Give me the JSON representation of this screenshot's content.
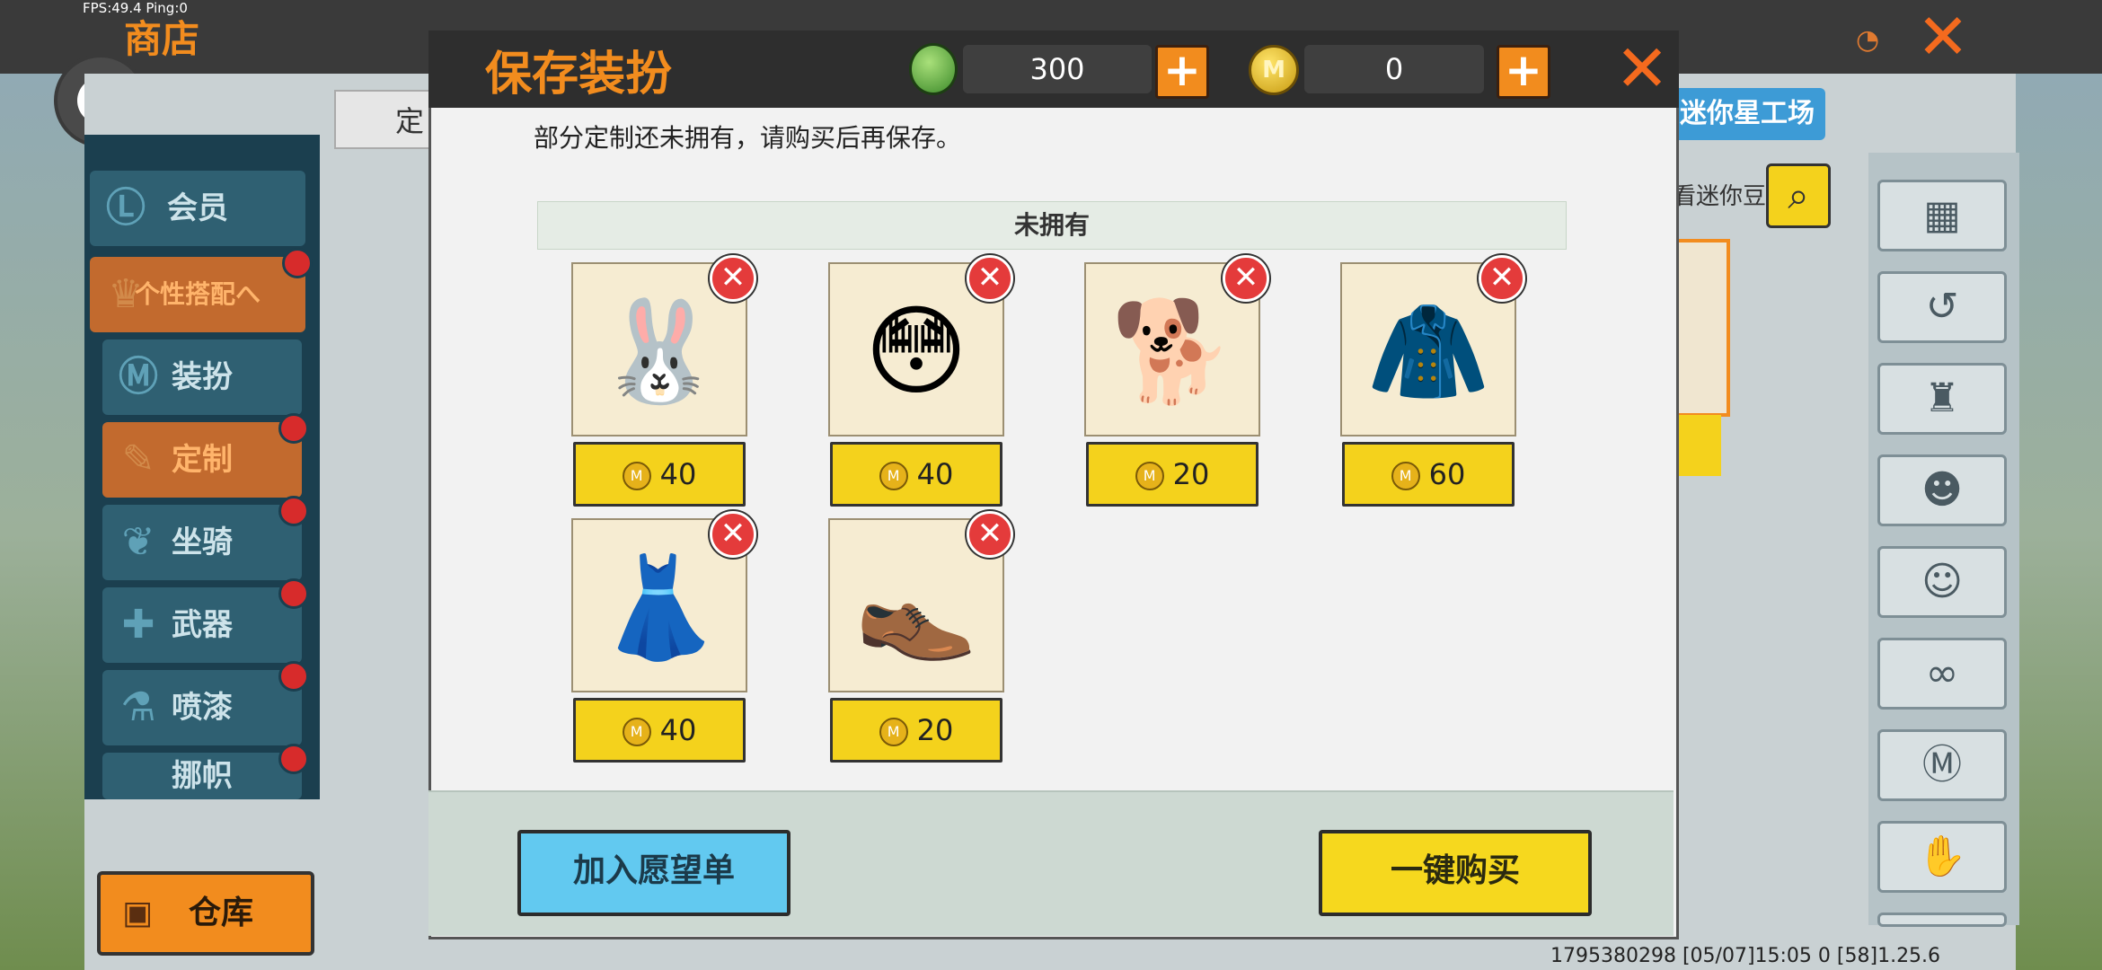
{
  "hud": {
    "fps": "FPS:49.4  Ping:0"
  },
  "shop": {
    "title": "商店",
    "tab_custom": "定",
    "workshop": "迷你星工场",
    "search_text": "看迷你豆",
    "storage": "仓库",
    "sidebar": [
      {
        "label": "会员",
        "active": false,
        "badge": false
      },
      {
        "label": "个性搭配へ",
        "active": true,
        "badge": true
      },
      {
        "label": "装扮",
        "active": false,
        "badge": false
      },
      {
        "label": "定制",
        "active": true,
        "badge": true
      },
      {
        "label": "坐骑",
        "active": false,
        "badge": true
      },
      {
        "label": "武器",
        "active": false,
        "badge": true
      },
      {
        "label": "喷漆",
        "active": false,
        "badge": true
      },
      {
        "label": "挪帜",
        "active": false,
        "badge": true
      }
    ]
  },
  "footer": {
    "info": "1795380298   [05/07]15:05 0   [58]1.25.6"
  },
  "modal": {
    "title": "保存装扮",
    "green_currency": "300",
    "coin_currency": "0",
    "coin_glyph": "M",
    "notice": "部分定制还未拥有，请购买后再保存。",
    "section": "未拥有",
    "items": [
      {
        "name": "bunny-hair",
        "price": "40"
      },
      {
        "name": "face",
        "price": "40"
      },
      {
        "name": "dog-mask",
        "price": "20"
      },
      {
        "name": "jacket",
        "price": "60"
      },
      {
        "name": "skirt",
        "price": "40"
      },
      {
        "name": "shoes",
        "price": "20"
      }
    ],
    "wishlist": "加入愿望单",
    "buy_all": "一键购买"
  }
}
